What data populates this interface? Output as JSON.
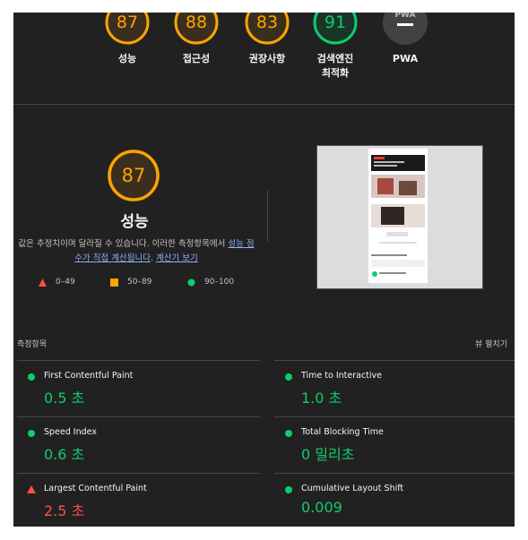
{
  "categories": [
    {
      "score": "87",
      "label": "성능",
      "status": "orange"
    },
    {
      "score": "88",
      "label": "접근성",
      "status": "orange"
    },
    {
      "score": "83",
      "label": "권장사항",
      "status": "orange"
    },
    {
      "score": "91",
      "label": "검색엔진 최적화",
      "label_line1": "검색엔진",
      "label_line2": "최적화",
      "status": "green"
    },
    {
      "score": "—",
      "label": "PWA",
      "status": "gray"
    }
  ],
  "performance": {
    "score": "87",
    "title": "성능",
    "desc_prefix": "값은 추정치이며 달라질 수 있습니다. 이러한 측정항목에서 ",
    "link1": "성능 점수가 직접 계산됩니다",
    "desc_mid": ". ",
    "link2": "계산기 보기"
  },
  "legend": [
    {
      "range": "0–49",
      "color": "#ff4e42"
    },
    {
      "range": "50–89",
      "color": "#ffa400"
    },
    {
      "range": "90–100",
      "color": "#0cce6b"
    }
  ],
  "metrics_title": "측정항목",
  "expand_view": "뷰 펼치기",
  "metrics": [
    {
      "name": "First Contentful Paint",
      "value": "0.5 초",
      "status": "green"
    },
    {
      "name": "Time to Interactive",
      "value": "1.0 초",
      "status": "green"
    },
    {
      "name": "Speed Index",
      "value": "0.6 초",
      "status": "green"
    },
    {
      "name": "Total Blocking Time",
      "value": "0 밀리초",
      "status": "green"
    },
    {
      "name": "Largest Contentful Paint",
      "value": "2.5 초",
      "status": "red"
    },
    {
      "name": "Cumulative Layout Shift",
      "value": "0.009",
      "status": "green"
    }
  ],
  "colors": {
    "bg": "#212121",
    "orange": "#ffa400",
    "green": "#0cce6b",
    "red": "#ff4e42",
    "link": "#8ab4f8"
  }
}
